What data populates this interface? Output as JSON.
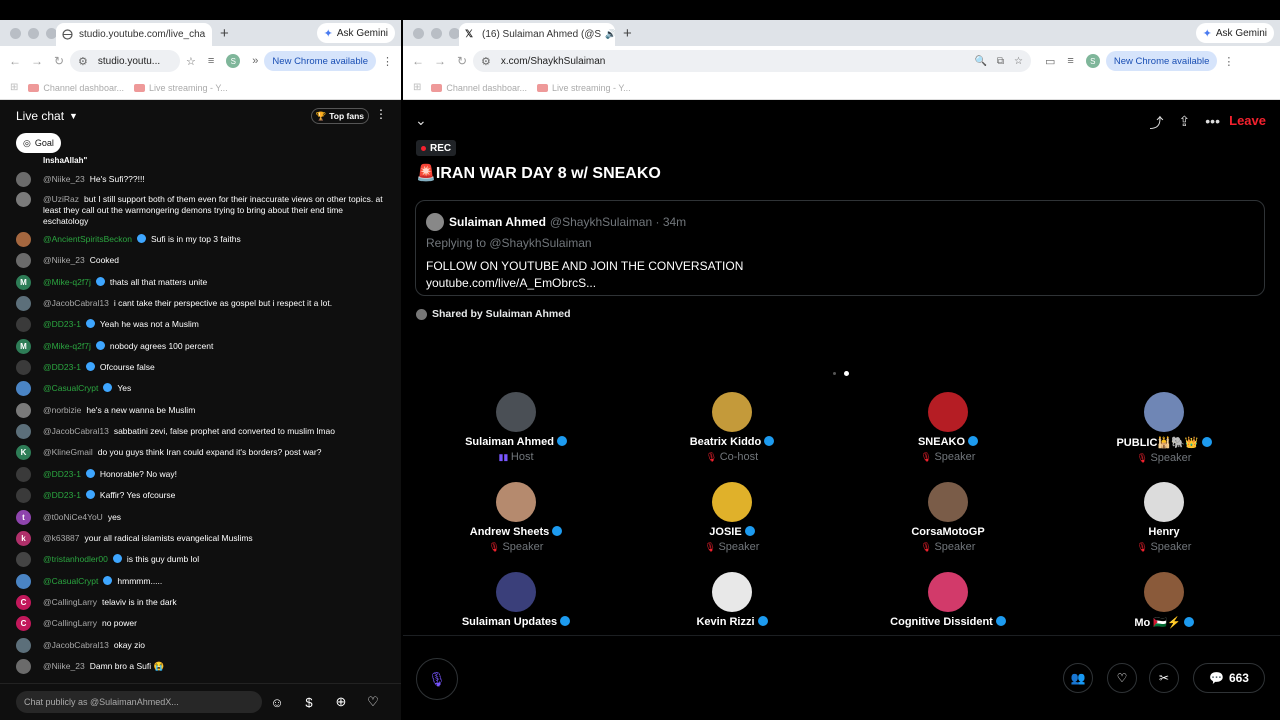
{
  "left_window": {
    "tab_title": "studio.youtube.com/live_cha",
    "tab_close": "×",
    "new_tab": "+",
    "ask_gemini": "Ask Gemini",
    "url": "studio.youtu...",
    "new_chrome": "New Chrome available",
    "profile_initial": "S",
    "bookmarks": [
      "Channel dashboar...",
      "Live streaming - Y..."
    ]
  },
  "right_window": {
    "tab_title": "(16) Sulaiman Ahmed (@S",
    "tab_close": "×",
    "new_tab": "+",
    "ask_gemini": "Ask Gemini",
    "url": "x.com/ShaykhSulaiman",
    "new_chrome": "New Chrome available",
    "profile_initial": "S",
    "bookmarks": [
      "Channel dashboar...",
      "Live streaming - Y..."
    ]
  },
  "live_chat": {
    "title": "Live chat",
    "top_fans": "Top fans",
    "goal": "Goal",
    "previous_text": "InshaAllah\"",
    "input_placeholder": "Chat publicly as @SulaimanAhmedX...",
    "messages": [
      {
        "name": "@Niike_23",
        "text": "He's Sufi???!!!",
        "green": false,
        "badge": false,
        "avatar_color": "#6b6b6b",
        "initial": ""
      },
      {
        "name": "@UziRaz",
        "text": "but I still support both of them even for their inaccurate views on other topics. at least they call out the warmongering demons trying to bring about their end time eschatology",
        "green": false,
        "badge": false,
        "avatar_color": "#7a7a7a",
        "initial": ""
      },
      {
        "name": "@AncientSpiritsBeckon",
        "text": "Sufi is in my top 3 faiths",
        "green": true,
        "badge": true,
        "avatar_color": "#a5673f",
        "initial": ""
      },
      {
        "name": "@Niike_23",
        "text": "Cooked",
        "green": false,
        "badge": false,
        "avatar_color": "#6b6b6b",
        "initial": ""
      },
      {
        "name": "@Mike-q2f7j",
        "text": "thats all that matters unite",
        "green": true,
        "badge": true,
        "avatar_color": "#2e7d57",
        "initial": "M"
      },
      {
        "name": "@JacobCabral13",
        "text": "i cant take their perspective as gospel but i respect it a lot.",
        "green": false,
        "badge": false,
        "avatar_color": "#5c6f7a",
        "initial": ""
      },
      {
        "name": "@DD23-1",
        "text": "Yeah he was not a Muslim",
        "green": true,
        "badge": true,
        "avatar_color": "#3a3a3a",
        "initial": ""
      },
      {
        "name": "@Mike-q2f7j",
        "text": "nobody agrees 100 percent",
        "green": true,
        "badge": true,
        "avatar_color": "#2e7d57",
        "initial": "M"
      },
      {
        "name": "@DD23-1",
        "text": "Ofcourse false",
        "green": true,
        "badge": true,
        "avatar_color": "#3a3a3a",
        "initial": ""
      },
      {
        "name": "@CasualCrypt",
        "text": "Yes",
        "green": true,
        "badge": true,
        "avatar_color": "#4a84c4",
        "initial": ""
      },
      {
        "name": "@norbizie",
        "text": "he's a new wanna be Muslim",
        "green": false,
        "badge": false,
        "avatar_color": "#7a7a7a",
        "initial": ""
      },
      {
        "name": "@JacobCabral13",
        "text": "sabbatini zevi, false prophet and converted to muslim lmao",
        "green": false,
        "badge": false,
        "avatar_color": "#5c6f7a",
        "initial": ""
      },
      {
        "name": "@KlineGmail",
        "text": "do you guys think Iran could expand it's borders? post war?",
        "green": false,
        "badge": false,
        "avatar_color": "#2e7d57",
        "initial": "K"
      },
      {
        "name": "@DD23-1",
        "text": "Honorable? No way!",
        "green": true,
        "badge": true,
        "avatar_color": "#3a3a3a",
        "initial": ""
      },
      {
        "name": "@DD23-1",
        "text": "Kaffir? Yes ofcourse",
        "green": true,
        "badge": true,
        "avatar_color": "#3a3a3a",
        "initial": ""
      },
      {
        "name": "@t0oNiCe4YoU",
        "text": "yes",
        "green": false,
        "badge": false,
        "avatar_color": "#8e44ad",
        "initial": "t"
      },
      {
        "name": "@k63887",
        "text": "your all radical islamists evangelical Muslims",
        "green": false,
        "badge": false,
        "avatar_color": "#b0306a",
        "initial": "k"
      },
      {
        "name": "@tristanhodler00",
        "text": "is this guy dumb lol",
        "green": true,
        "badge": true,
        "avatar_color": "#444444",
        "initial": ""
      },
      {
        "name": "@CasualCrypt",
        "text": "hmmmm.....",
        "green": true,
        "badge": true,
        "avatar_color": "#4a84c4",
        "initial": ""
      },
      {
        "name": "@CallingLarry",
        "text": "telaviv is in the dark",
        "green": false,
        "badge": false,
        "avatar_color": "#c2185b",
        "initial": "C"
      },
      {
        "name": "@CallingLarry",
        "text": "no power",
        "green": false,
        "badge": false,
        "avatar_color": "#c2185b",
        "initial": "C"
      },
      {
        "name": "@JacobCabral13",
        "text": "okay zio",
        "green": false,
        "badge": false,
        "avatar_color": "#5c6f7a",
        "initial": ""
      },
      {
        "name": "@Niike_23",
        "text": "Damn bro a Sufi 😭",
        "green": false,
        "badge": false,
        "avatar_color": "#6b6b6b",
        "initial": ""
      }
    ]
  },
  "space": {
    "rec_label": "REC",
    "title_icon": "🚨",
    "title": "IRAN WAR DAY 8 w/ SNEAKO",
    "leave_label": "Leave",
    "tweet": {
      "name": "Sulaiman Ahmed",
      "handle_time": "@ShaykhSulaiman · 34m",
      "replying_to": "Replying to @ShaykhSulaiman",
      "line1": "FOLLOW ON YOUTUBE AND JOIN THE CONVERSATION",
      "line2": "youtube.com/live/A_EmObrcS..."
    },
    "shared_by": "Shared by Sulaiman Ahmed",
    "participants": [
      {
        "name": "Sulaiman Ahmed",
        "role": "Host",
        "verified": true,
        "avatar_color": "#4a4f55"
      },
      {
        "name": "Beatrix Kiddo",
        "role": "Co-host",
        "verified": true,
        "avatar_color": "#c49a3a"
      },
      {
        "name": "SNEAKO",
        "role": "Speaker",
        "verified": true,
        "avatar_color": "#b51d24"
      },
      {
        "name": "PUBLIC🕌🐘👑",
        "role": "Speaker",
        "verified": true,
        "avatar_color": "#6f86b5"
      },
      {
        "name": "Andrew Sheets",
        "role": "Speaker",
        "verified": true,
        "avatar_color": "#b58a6e"
      },
      {
        "name": "JOSIE",
        "role": "Speaker",
        "verified": true,
        "avatar_color": "#e0b12a"
      },
      {
        "name": "CorsaMotoGP",
        "role": "Speaker",
        "verified": false,
        "avatar_color": "#7a5c48"
      },
      {
        "name": "Henry",
        "role": "Speaker",
        "verified": false,
        "avatar_color": "#dcdcdc"
      },
      {
        "name": "Sulaiman Updates",
        "role": "",
        "verified": true,
        "avatar_color": "#3a3f7a"
      },
      {
        "name": "Kevin Rizzi",
        "role": "",
        "verified": true,
        "avatar_color": "#e8e8e8"
      },
      {
        "name": "Cognitive Dissident",
        "role": "",
        "verified": true,
        "avatar_color": "#d23a6a"
      },
      {
        "name": "Mo 🇵🇸⚡",
        "role": "",
        "verified": true,
        "avatar_color": "#8a5a3a"
      }
    ],
    "comments_count": "663"
  }
}
